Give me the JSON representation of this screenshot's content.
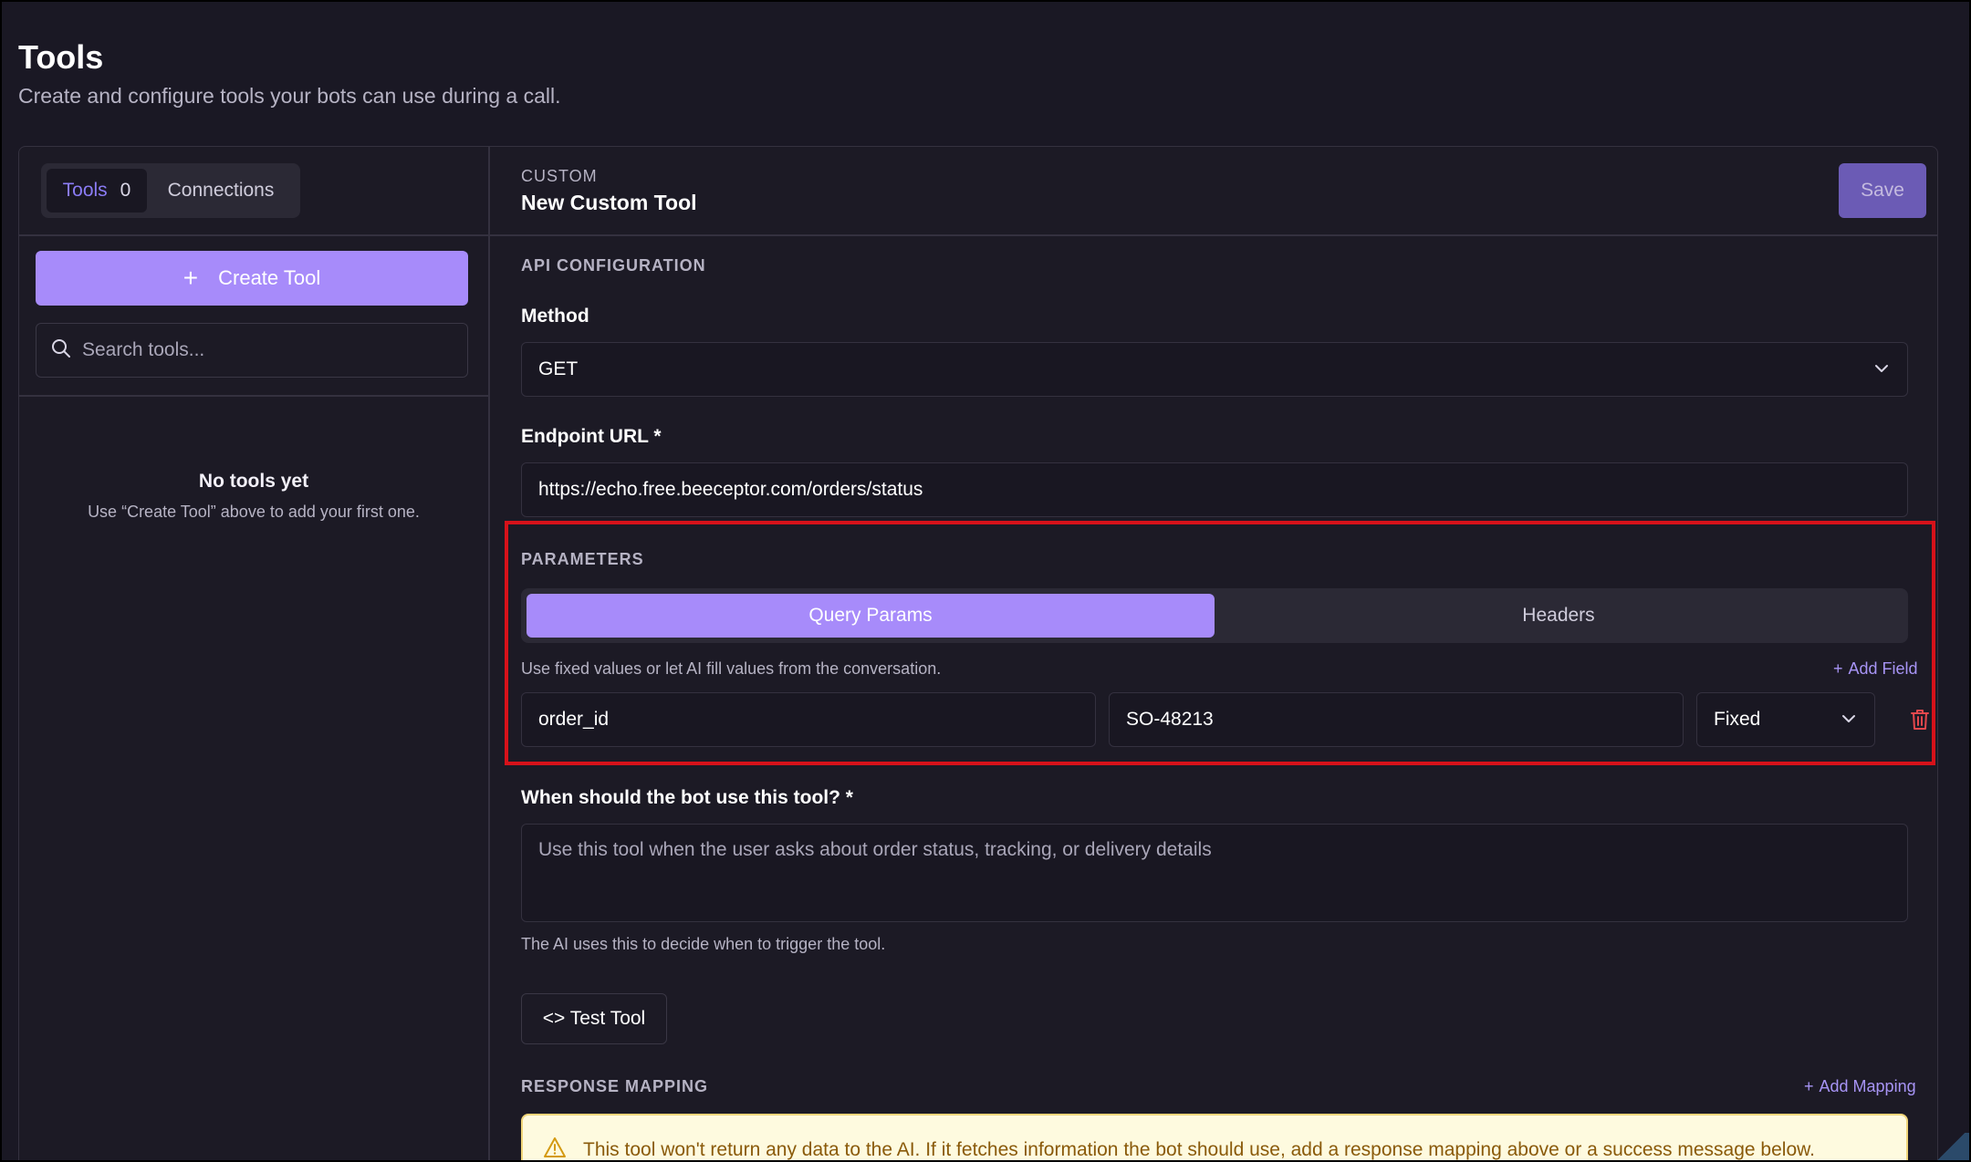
{
  "page": {
    "title": "Tools",
    "subtitle": "Create and configure tools your bots can use during a call."
  },
  "sidebar": {
    "tabs": {
      "tools_label": "Tools",
      "tools_count": "0",
      "connections_label": "Connections"
    },
    "create_button": "Create Tool",
    "search_placeholder": "Search tools...",
    "empty_title": "No tools yet",
    "empty_text": "Use “Create Tool” above to add your first one."
  },
  "editor": {
    "category": "CUSTOM",
    "name": "New Custom Tool",
    "save_label": "Save",
    "api_section": "API CONFIGURATION",
    "method_label": "Method",
    "method_value": "GET",
    "endpoint_label": "Endpoint URL *",
    "endpoint_value": "https://echo.free.beeceptor.com/orders/status",
    "parameters_section": "PARAMETERS",
    "param_tabs": [
      "Query Params",
      "Headers"
    ],
    "param_hint": "Use fixed values or let AI fill values from the conversation.",
    "add_field": "Add Field",
    "param_row": {
      "key": "order_id",
      "value": "SO-48213",
      "mode": "Fixed"
    },
    "when_label": "When should the bot use this tool? *",
    "when_placeholder": "Use this tool when the user asks about order status, tracking, or delivery details",
    "when_hint": "The AI uses this to decide when to trigger the tool.",
    "test_button": "<> Test Tool",
    "response_section": "RESPONSE MAPPING",
    "add_mapping": "Add Mapping",
    "warning_text": "This tool won't return any data to the AI. If it fetches information the bot should use, add a response mapping above or a success message below."
  },
  "colors": {
    "accent": "#a78bfa",
    "background": "#1a1824",
    "danger": "#e5484d",
    "highlight": "#d6121a",
    "warning_bg": "#fefadf"
  },
  "icons": [
    "plus-icon",
    "search-icon",
    "chevron-down-icon",
    "trash-icon",
    "warning-icon"
  ]
}
